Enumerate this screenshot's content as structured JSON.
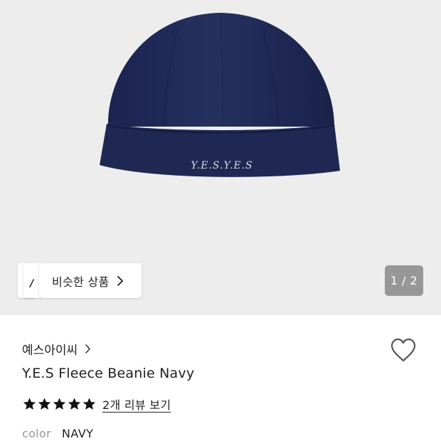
{
  "product": {
    "brand": "예스아이씨",
    "title": "Y.E.S Fleece Beanie Navy",
    "rating_stars": 5,
    "review_link": "2개 리뷰 보기",
    "option_label": "color",
    "option_value": "NAVY"
  },
  "gallery": {
    "pager": "1 / 2",
    "similar_label": "비슷한 상품",
    "similar_thumb_glyph": "/",
    "image_logo_text": "Y.E.S.Y.E.S"
  },
  "colors": {
    "gallery_bg": "#ededed",
    "beanie": "#1f2a57",
    "text": "#222222",
    "muted": "#9a9a9a"
  },
  "icons": {
    "heart": "heart-outline-icon",
    "star": "star-filled-icon",
    "chevron": "chevron-right-icon"
  }
}
